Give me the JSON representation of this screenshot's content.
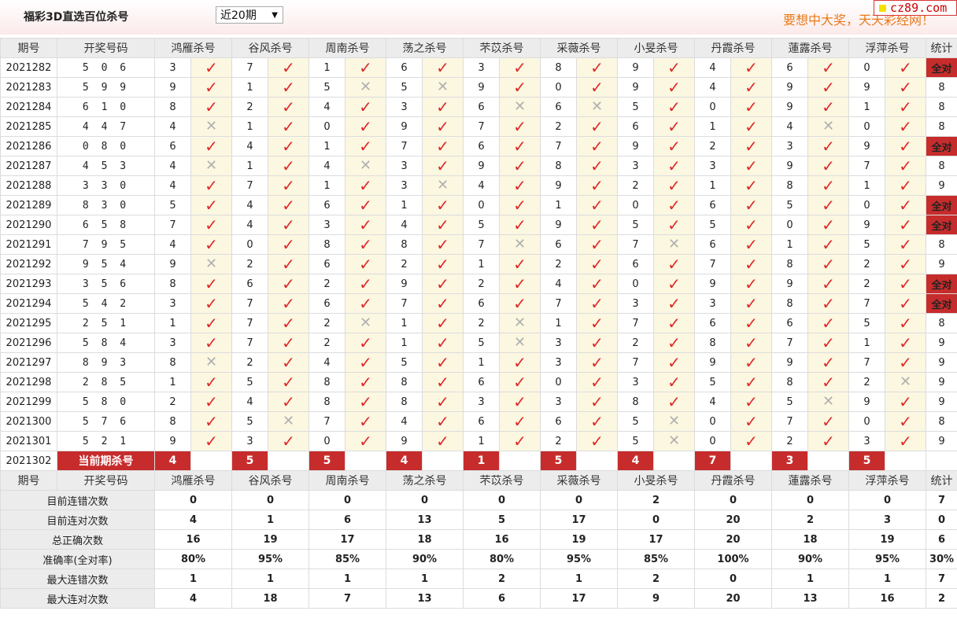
{
  "page": {
    "title": "福彩3D直选百位杀号",
    "period_select": "近20期",
    "slogan": "要想中大奖，天天彩经网！",
    "logo_text": "cz89.com"
  },
  "headers": [
    "期号",
    "开奖号码",
    "鸿雁杀号",
    "谷风杀号",
    "周南杀号",
    "荡之杀号",
    "芣苡杀号",
    "采薇杀号",
    "小旻杀号",
    "丹霞杀号",
    "蓮露杀号",
    "浮萍杀号",
    "统计"
  ],
  "rows": [
    {
      "period": "2021282",
      "number": "5 0 6",
      "kills": [
        3,
        7,
        1,
        6,
        3,
        8,
        9,
        4,
        6,
        0
      ],
      "hits": [
        1,
        1,
        1,
        1,
        1,
        1,
        1,
        1,
        1,
        1
      ],
      "count": "全对"
    },
    {
      "period": "2021283",
      "number": "5 9 9",
      "kills": [
        9,
        1,
        5,
        5,
        9,
        0,
        9,
        4,
        9,
        9
      ],
      "hits": [
        1,
        1,
        0,
        0,
        1,
        1,
        1,
        1,
        1,
        1
      ],
      "count": "8"
    },
    {
      "period": "2021284",
      "number": "6 1 0",
      "kills": [
        8,
        2,
        4,
        3,
        6,
        6,
        5,
        0,
        9,
        1
      ],
      "hits": [
        1,
        1,
        1,
        1,
        0,
        0,
        1,
        1,
        1,
        1
      ],
      "count": "8"
    },
    {
      "period": "2021285",
      "number": "4 4 7",
      "kills": [
        4,
        1,
        0,
        9,
        7,
        2,
        6,
        1,
        4,
        0
      ],
      "hits": [
        0,
        1,
        1,
        1,
        1,
        1,
        1,
        1,
        0,
        1
      ],
      "count": "8"
    },
    {
      "period": "2021286",
      "number": "0 8 0",
      "kills": [
        6,
        4,
        1,
        7,
        6,
        7,
        9,
        2,
        3,
        9
      ],
      "hits": [
        1,
        1,
        1,
        1,
        1,
        1,
        1,
        1,
        1,
        1
      ],
      "count": "全对"
    },
    {
      "period": "2021287",
      "number": "4 5 3",
      "kills": [
        4,
        1,
        4,
        3,
        9,
        8,
        3,
        3,
        9,
        7
      ],
      "hits": [
        0,
        1,
        0,
        1,
        1,
        1,
        1,
        1,
        1,
        1
      ],
      "count": "8"
    },
    {
      "period": "2021288",
      "number": "3 3 0",
      "kills": [
        4,
        7,
        1,
        3,
        4,
        9,
        2,
        1,
        8,
        1
      ],
      "hits": [
        1,
        1,
        1,
        0,
        1,
        1,
        1,
        1,
        1,
        1
      ],
      "count": "9"
    },
    {
      "period": "2021289",
      "number": "8 3 0",
      "kills": [
        5,
        4,
        6,
        1,
        0,
        1,
        0,
        6,
        5,
        0
      ],
      "hits": [
        1,
        1,
        1,
        1,
        1,
        1,
        1,
        1,
        1,
        1
      ],
      "count": "全对"
    },
    {
      "period": "2021290",
      "number": "6 5 8",
      "kills": [
        7,
        4,
        3,
        4,
        5,
        9,
        5,
        5,
        0,
        9
      ],
      "hits": [
        1,
        1,
        1,
        1,
        1,
        1,
        1,
        1,
        1,
        1
      ],
      "count": "全对"
    },
    {
      "period": "2021291",
      "number": "7 9 5",
      "kills": [
        4,
        0,
        8,
        8,
        7,
        6,
        7,
        6,
        1,
        5
      ],
      "hits": [
        1,
        1,
        1,
        1,
        0,
        1,
        0,
        1,
        1,
        1
      ],
      "count": "8"
    },
    {
      "period": "2021292",
      "number": "9 5 4",
      "kills": [
        9,
        2,
        6,
        2,
        1,
        2,
        6,
        7,
        8,
        2
      ],
      "hits": [
        0,
        1,
        1,
        1,
        1,
        1,
        1,
        1,
        1,
        1
      ],
      "count": "9"
    },
    {
      "period": "2021293",
      "number": "3 5 6",
      "kills": [
        8,
        6,
        2,
        9,
        2,
        4,
        0,
        9,
        9,
        2
      ],
      "hits": [
        1,
        1,
        1,
        1,
        1,
        1,
        1,
        1,
        1,
        1
      ],
      "count": "全对"
    },
    {
      "period": "2021294",
      "number": "5 4 2",
      "kills": [
        3,
        7,
        6,
        7,
        6,
        7,
        3,
        3,
        8,
        7
      ],
      "hits": [
        1,
        1,
        1,
        1,
        1,
        1,
        1,
        1,
        1,
        1
      ],
      "count": "全对"
    },
    {
      "period": "2021295",
      "number": "2 5 1",
      "kills": [
        1,
        7,
        2,
        1,
        2,
        1,
        7,
        6,
        6,
        5
      ],
      "hits": [
        1,
        1,
        0,
        1,
        0,
        1,
        1,
        1,
        1,
        1
      ],
      "count": "8"
    },
    {
      "period": "2021296",
      "number": "5 8 4",
      "kills": [
        3,
        7,
        2,
        1,
        5,
        3,
        2,
        8,
        7,
        1
      ],
      "hits": [
        1,
        1,
        1,
        1,
        0,
        1,
        1,
        1,
        1,
        1
      ],
      "count": "9"
    },
    {
      "period": "2021297",
      "number": "8 9 3",
      "kills": [
        8,
        2,
        4,
        5,
        1,
        3,
        7,
        9,
        9,
        7
      ],
      "hits": [
        0,
        1,
        1,
        1,
        1,
        1,
        1,
        1,
        1,
        1
      ],
      "count": "9"
    },
    {
      "period": "2021298",
      "number": "2 8 5",
      "kills": [
        1,
        5,
        8,
        8,
        6,
        0,
        3,
        5,
        8,
        2
      ],
      "hits": [
        1,
        1,
        1,
        1,
        1,
        1,
        1,
        1,
        1,
        0
      ],
      "count": "9"
    },
    {
      "period": "2021299",
      "number": "5 8 0",
      "kills": [
        2,
        4,
        8,
        8,
        3,
        3,
        8,
        4,
        5,
        9
      ],
      "hits": [
        1,
        1,
        1,
        1,
        1,
        1,
        1,
        1,
        0,
        1
      ],
      "count": "9"
    },
    {
      "period": "2021300",
      "number": "5 7 6",
      "kills": [
        8,
        5,
        7,
        4,
        6,
        6,
        5,
        0,
        7,
        0
      ],
      "hits": [
        1,
        0,
        1,
        1,
        1,
        1,
        0,
        1,
        1,
        1
      ],
      "count": "8"
    },
    {
      "period": "2021301",
      "number": "5 2 1",
      "kills": [
        9,
        3,
        0,
        9,
        1,
        2,
        5,
        0,
        2,
        3
      ],
      "hits": [
        1,
        1,
        1,
        1,
        1,
        1,
        0,
        1,
        1,
        1
      ],
      "count": "9"
    }
  ],
  "current": {
    "period": "2021302",
    "label": "当前期杀号",
    "kills": [
      "4",
      "5",
      "5",
      "4",
      "1",
      "5",
      "4",
      "7",
      "3",
      "5"
    ]
  },
  "stats": [
    {
      "label": "目前连错次数",
      "values": [
        "0",
        "0",
        "0",
        "0",
        "0",
        "0",
        "2",
        "0",
        "0",
        "0"
      ],
      "total": "7",
      "style": "blue"
    },
    {
      "label": "目前连对次数",
      "values": [
        "4",
        "1",
        "6",
        "13",
        "5",
        "17",
        "0",
        "20",
        "2",
        "3"
      ],
      "total": "0",
      "style": "blue"
    },
    {
      "label": "总正确次数",
      "values": [
        "16",
        "19",
        "17",
        "18",
        "16",
        "19",
        "17",
        "20",
        "18",
        "19"
      ],
      "total": "6",
      "style": "blue"
    },
    {
      "label": "准确率(全对率)",
      "values": [
        "80%",
        "95%",
        "85%",
        "90%",
        "80%",
        "95%",
        "85%",
        "100%",
        "90%",
        "95%"
      ],
      "total": "30%",
      "style": "red"
    },
    {
      "label": "最大连错次数",
      "values": [
        "1",
        "1",
        "1",
        "1",
        "2",
        "1",
        "2",
        "0",
        "1",
        "1"
      ],
      "total": "7",
      "style": "blue"
    },
    {
      "label": "最大连对次数",
      "values": [
        "4",
        "18",
        "7",
        "13",
        "6",
        "17",
        "9",
        "20",
        "13",
        "16"
      ],
      "total": "2",
      "style": "blue"
    }
  ]
}
